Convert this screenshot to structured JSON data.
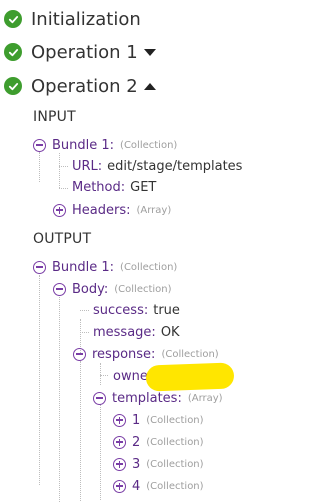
{
  "steps": [
    {
      "title": "Initialization",
      "status": "success",
      "expand": ""
    },
    {
      "title": "Operation 1",
      "status": "success",
      "expand": "collapsed"
    },
    {
      "title": "Operation 2",
      "status": "success",
      "expand": "expanded"
    }
  ],
  "input": {
    "section_label": "INPUT",
    "bundle": {
      "key": "Bundle 1:",
      "type": "(Collection)"
    },
    "fields": {
      "url": {
        "key": "URL:",
        "value": "edit/stage/templates"
      },
      "method": {
        "key": "Method:",
        "value": "GET"
      },
      "headers": {
        "key": "Headers:",
        "type": "(Array)"
      }
    }
  },
  "output": {
    "section_label": "OUTPUT",
    "bundle": {
      "key": "Bundle 1:",
      "type": "(Collection)"
    },
    "body": {
      "key": "Body:",
      "type": "(Collection)"
    },
    "success": {
      "key": "success:",
      "value": "true"
    },
    "message": {
      "key": "message:",
      "value": "OK"
    },
    "response": {
      "key": "response:",
      "type": "(Collection)"
    },
    "owner": {
      "key": "owner:"
    },
    "templates": {
      "key": "templates:",
      "type": "(Array)"
    },
    "template_items": [
      {
        "key": "1",
        "type": "(Collection)"
      },
      {
        "key": "2",
        "type": "(Collection)"
      },
      {
        "key": "3",
        "type": "(Collection)"
      },
      {
        "key": "4",
        "type": "(Collection)"
      }
    ]
  },
  "colors": {
    "success": "#3e9d2e",
    "key": "#5a2a86",
    "toggle": "#7a3ea6",
    "type_label": "#9e9e9e",
    "redaction": "#ffe600"
  },
  "icons": {
    "status": "check-circle-icon",
    "expand": "caret-down-icon",
    "collapse": "caret-up-icon",
    "tree_expand": "plus-circle-icon",
    "tree_collapse": "minus-circle-icon"
  }
}
